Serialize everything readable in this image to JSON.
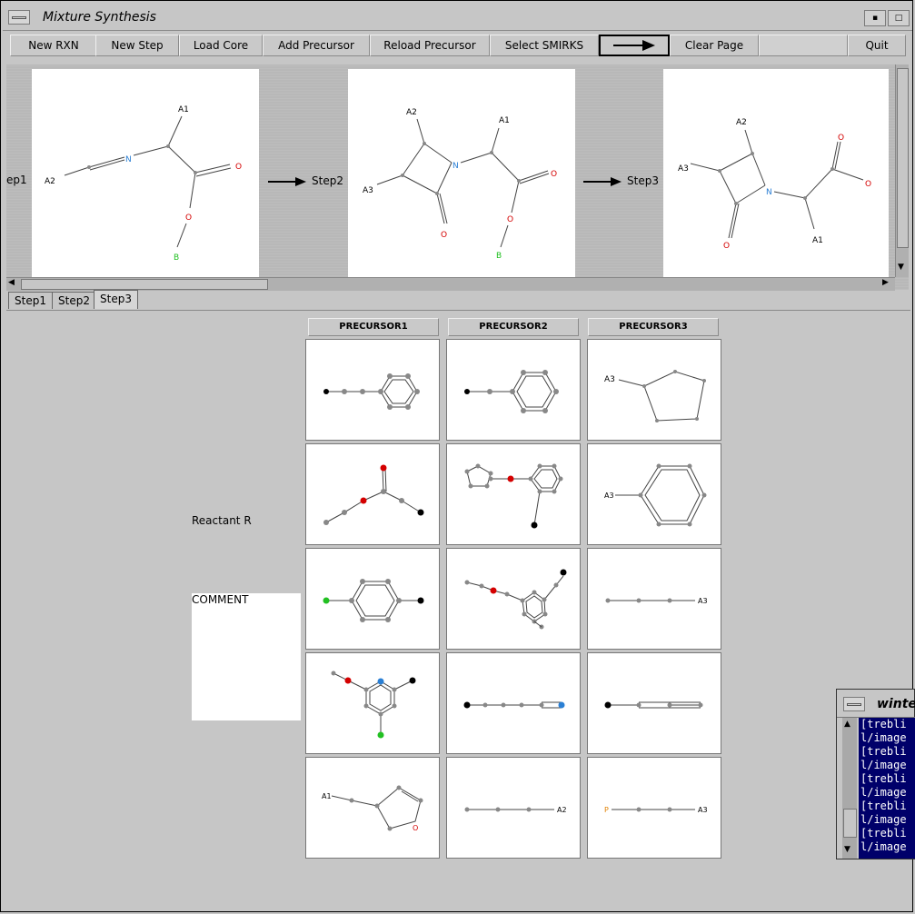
{
  "window": {
    "title": "Mixture Synthesis"
  },
  "toolbar": {
    "buttons": [
      "New RXN",
      "New Step",
      "Load Core",
      "Add Precursor",
      "Reload Precursor",
      "Select SMIRKS",
      "Clear Page",
      "Quit"
    ],
    "arrow_icon": "right-arrow-icon"
  },
  "reaction": {
    "steps": [
      "ep1",
      "Step2",
      "Step3"
    ],
    "panel1": {
      "labels": [
        "A1",
        "A2",
        "N",
        "O",
        "O",
        "B"
      ]
    },
    "panel2": {
      "labels": [
        "A2",
        "A1",
        "A3",
        "N",
        "O",
        "O",
        "O",
        "B"
      ]
    },
    "panel3": {
      "labels": [
        "A2",
        "A3",
        "N",
        "O",
        "O",
        "O",
        "A1"
      ]
    }
  },
  "tabs": [
    "Step1",
    "Step2",
    "Step3"
  ],
  "grid": {
    "headers": [
      "PRECURSOR1",
      "PRECURSOR2",
      "PRECURSOR3"
    ],
    "reactant_label": "Reactant R",
    "comment_label": "COMMENT",
    "cell_labels": {
      "r0c2": "A3",
      "r1c2": "A3",
      "r2c2": "A3",
      "r4c0": "A1",
      "r4c0_o": "O",
      "r4c1": "A2",
      "r4c2_p": "P",
      "r4c2": "A3"
    }
  },
  "log_window": {
    "title": "winter",
    "lines": [
      "[trebli",
      "l/image",
      "[trebli",
      "l/image",
      "[trebli",
      "l/image",
      "[trebli",
      "l/image",
      "[trebli",
      "l/image"
    ]
  },
  "colors": {
    "nitrogen": "#2a7fd4",
    "oxygen": "#d40000",
    "boron": "#22c022",
    "phosphorus": "#e08000"
  }
}
